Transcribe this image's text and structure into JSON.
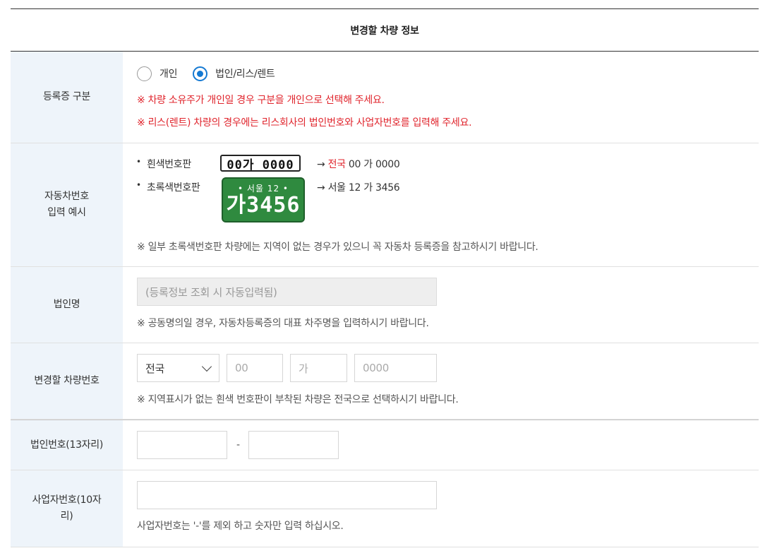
{
  "section_title": "변경할 차량 정보",
  "registration_type": {
    "label": "등록증 구분",
    "options": [
      "개인",
      "법인/리스/렌트"
    ],
    "selected_index": 1,
    "warnings": [
      "※ 차량 소유주가 개인일 경우 구분을 개인으로 선택해 주세요.",
      "※ 리스(렌트) 차량의 경우에는 리스회사의 법인번호와 사업자번호를 입력해 주세요."
    ]
  },
  "plate_example": {
    "label_line1": "자동차번호",
    "label_line2": "입력 예시",
    "bullet": "•",
    "white": {
      "name": "흰색번호판",
      "plate_text": "00가 0000",
      "arrow": "→",
      "result_highlight": "전국",
      "result_rest": " 00 가 0000"
    },
    "green": {
      "name": "초록색번호판",
      "plate_top": "•  서울 12  •",
      "plate_bottom": "가3456",
      "result": "→ 서울 12 가 3456"
    },
    "note": "※ 일부 초록색번호판 차량에는 지역이 없는 경우가 있으니 꼭 자동차 등록증을 참고하시기 바랍니다."
  },
  "corp_name": {
    "label": "법인명",
    "placeholder": "(등록정보 조회 시 자동입력됨)",
    "note": "※ 공동명의일 경우, 자동차등록증의 대표 차주명을 입력하시기 바랍니다."
  },
  "vehicle_number": {
    "label": "변경할 차량번호",
    "region_selected": "전국",
    "num_placeholder": "00",
    "char_placeholder": "가",
    "serial_placeholder": "0000",
    "note": "※ 지역표시가 없는 흰색 번호판이 부착된 차량은 전국으로 선택하시기 바랍니다."
  },
  "corp_number": {
    "label": "법인번호(13자리)",
    "separator": "-"
  },
  "business_number": {
    "label_line1": "사업자번호(10자",
    "label_line2": "리)",
    "note": "사업자번호는 '-'를 제외 하고 숫자만 입력 하십시오."
  },
  "colors": {
    "accent": "#1479d2",
    "warning": "#e0242c",
    "header_bg": "#eef4fa",
    "green_plate": "#2f8a3f"
  }
}
